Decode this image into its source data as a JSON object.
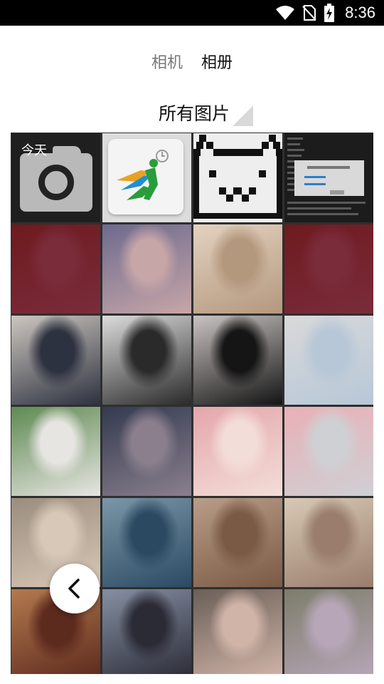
{
  "status_bar": {
    "time": "8:36",
    "icons": [
      "wifi-icon",
      "no-sim-icon",
      "battery-charging-icon"
    ]
  },
  "tabs": [
    {
      "label": "相机",
      "active": false
    },
    {
      "label": "相册",
      "active": true
    }
  ],
  "album_selector": {
    "label": "所有图片",
    "icon": "dropdown-triangle-icon"
  },
  "grid": {
    "section_label": "今天",
    "first_row": [
      "camera-icon",
      "app-icon-thumbnail",
      "pixel-cat-thumbnail",
      "screenshot-thumbnail"
    ],
    "photo_colors": [
      [
        "#6e1a1f",
        "#7a2c3b"
      ],
      [
        "#6d6a8e",
        "#c7a6a8"
      ],
      [
        "#e3d2c0",
        "#b4987e"
      ],
      [
        "#6e1a1f",
        "#7a2c3b"
      ],
      [
        "#cdc6bf",
        "#2d3240"
      ],
      [
        "#dcdcdc",
        "#2a2a2a"
      ],
      [
        "#c9c3c1",
        "#151515"
      ],
      [
        "#d9d9d9",
        "#b7c7d8"
      ],
      [
        "#5e8a52",
        "#e7e5e2"
      ],
      [
        "#333a50",
        "#8b7f8d"
      ],
      [
        "#e4a7ab",
        "#f3ddd8"
      ],
      [
        "#e9b0b6",
        "#cfd0d4"
      ],
      [
        "#9b8d7d",
        "#d8c8b8"
      ],
      [
        "#7b97a8",
        "#2b4a62"
      ],
      [
        "#b99d88",
        "#7a5a44"
      ],
      [
        "#d7c9b5",
        "#9a7d6d"
      ],
      [
        "#b37a4e",
        "#5d2a1e"
      ],
      [
        "#8690a3",
        "#2b2b36"
      ],
      [
        "#6a5f57",
        "#d1b4a8"
      ],
      [
        "#7d7d6a",
        "#b7a6b8"
      ]
    ]
  },
  "back_button": {
    "icon": "chevron-left-icon"
  }
}
